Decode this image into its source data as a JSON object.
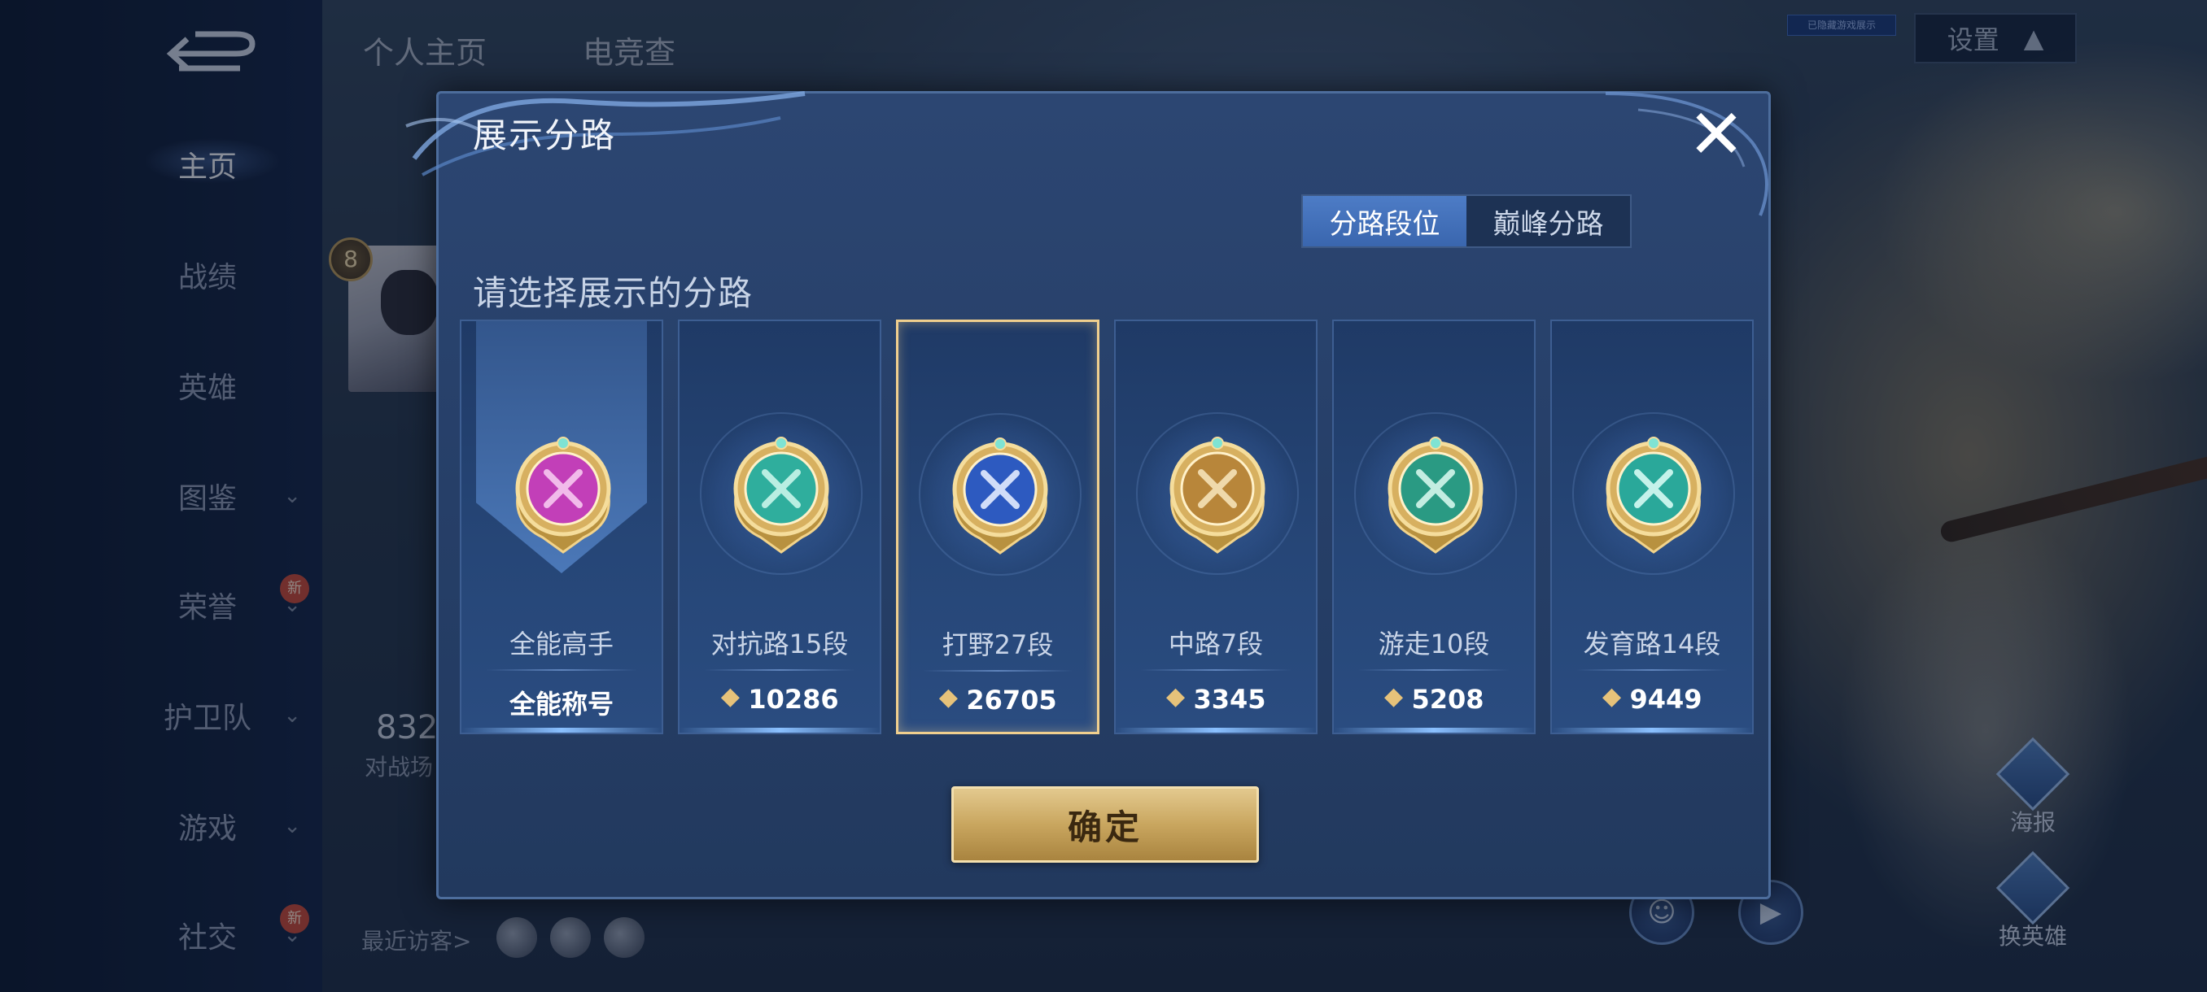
{
  "background": {
    "top_tabs": [
      "个人主页",
      "电竞查"
    ],
    "settings_label": "设置",
    "tiny_tag": "已隐藏游戏展示",
    "level": "8",
    "stat_value": "832",
    "stat_label": "对战场",
    "recent_visitors_label": "最近访客>",
    "side_actions": [
      "海报",
      "换英雄"
    ]
  },
  "sidebar": {
    "items": [
      {
        "label": "主页",
        "active": true,
        "chevron": false,
        "new": false
      },
      {
        "label": "战绩",
        "chevron": false,
        "new": false
      },
      {
        "label": "英雄",
        "chevron": false,
        "new": false
      },
      {
        "label": "图鉴",
        "chevron": true,
        "new": false
      },
      {
        "label": "荣誉",
        "chevron": true,
        "new": true
      },
      {
        "label": "护卫队",
        "chevron": true,
        "new": false
      },
      {
        "label": "游戏",
        "chevron": true,
        "new": false
      },
      {
        "label": "社交",
        "chevron": true,
        "new": true
      }
    ],
    "new_badge_text": "新"
  },
  "modal": {
    "title": "展示分路",
    "close_icon": "close-icon",
    "toggle": {
      "option_1": "分路段位",
      "option_2": "巅峰分路",
      "active": 1
    },
    "subtitle": "请选择展示的分路",
    "cards": [
      {
        "name": "全能高手",
        "score": "全能称号",
        "has_points_icon": false,
        "badge_color": "#c23fb8",
        "badge_accent": "#f7c9f0"
      },
      {
        "name": "对抗路15段",
        "score": "10286",
        "has_points_icon": true,
        "badge_color": "#2fae9d",
        "badge_accent": "#c9f5ea"
      },
      {
        "name": "打野27段",
        "score": "26705",
        "has_points_icon": true,
        "selected": true,
        "badge_color": "#2d5ac0",
        "badge_accent": "#e3ecff"
      },
      {
        "name": "中路7段",
        "score": "3345",
        "has_points_icon": true,
        "badge_color": "#b8863a",
        "badge_accent": "#f6e2b8"
      },
      {
        "name": "游走10段",
        "score": "5208",
        "has_points_icon": true,
        "badge_color": "#2a9a83",
        "badge_accent": "#d4f7ec"
      },
      {
        "name": "发育路14段",
        "score": "9449",
        "has_points_icon": true,
        "badge_color": "#2aa89a",
        "badge_accent": "#d6fbf3"
      }
    ],
    "confirm_label": "确定"
  },
  "colors": {
    "modal_bg": "#263f68",
    "toggle_active": "#4d7cc6",
    "selected_border": "#f0cf8e",
    "confirm_gold": "#c9a65f"
  }
}
